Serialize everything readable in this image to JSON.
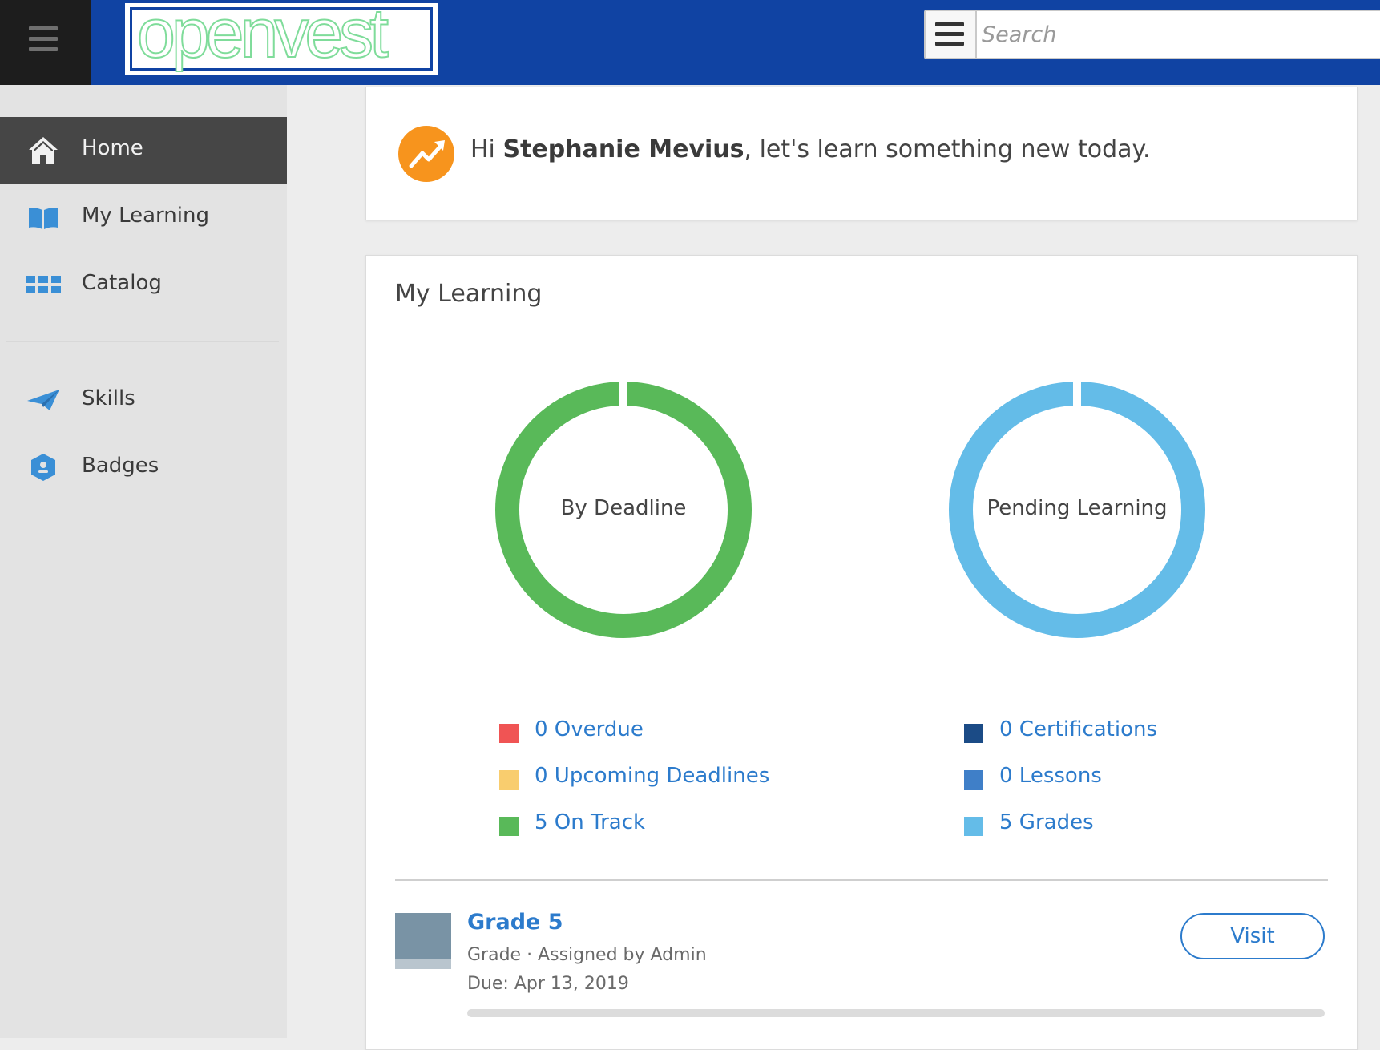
{
  "header": {
    "logo_text": "openvest",
    "search": {
      "placeholder": "Search",
      "value": ""
    }
  },
  "sidebar": {
    "items": [
      {
        "label": "Home",
        "icon": "home-icon",
        "active": true
      },
      {
        "label": "My Learning",
        "icon": "book-icon",
        "active": false
      },
      {
        "label": "Catalog",
        "icon": "grid-icon",
        "active": false
      },
      {
        "label": "Skills",
        "icon": "paper-plane-icon",
        "active": false
      },
      {
        "label": "Badges",
        "icon": "badge-icon",
        "active": false
      }
    ]
  },
  "welcome": {
    "greeting_prefix": "Hi",
    "user_name": "Stephanie Mevius",
    "greeting_suffix": ", let's learn something new today."
  },
  "my_learning": {
    "title": "My Learning",
    "by_deadline": {
      "label": "By Deadline",
      "legend": [
        {
          "text": "0 Overdue",
          "color": "#f05454"
        },
        {
          "text": "0 Upcoming Deadlines",
          "color": "#f9cd6e"
        },
        {
          "text": "5 On Track",
          "color": "#59b959"
        }
      ]
    },
    "pending": {
      "label": "Pending Learning",
      "legend": [
        {
          "text": "0 Certifications",
          "color": "#1b4b86"
        },
        {
          "text": "0 Lessons",
          "color": "#3f7fc8"
        },
        {
          "text": "5 Grades",
          "color": "#64bce8"
        }
      ]
    },
    "item": {
      "title": "Grade 5",
      "meta": "Grade · Assigned by Admin",
      "due": "Due: Apr 13, 2019",
      "progress": 0,
      "action_label": "Visit"
    }
  },
  "colors": {
    "topbar": "#1043a3",
    "accent": "#2c7bcc",
    "on_track": "#59b959",
    "grades": "#64bce8"
  }
}
